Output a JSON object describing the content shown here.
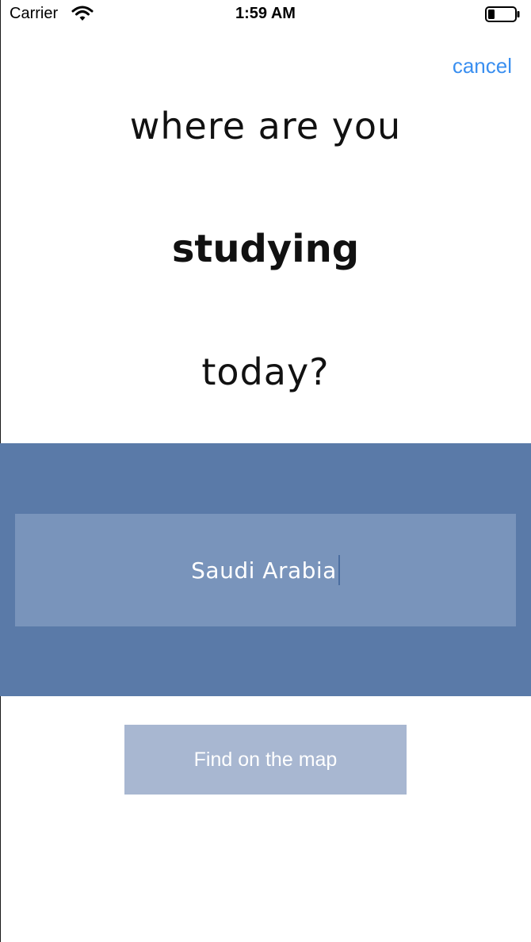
{
  "status_bar": {
    "carrier": "Carrier",
    "time": "1:59 AM",
    "wifi_icon": "wifi-icon",
    "battery_icon": "battery-icon"
  },
  "header": {
    "cancel_label": "cancel"
  },
  "question": {
    "line1": "where are you",
    "line2": "studying",
    "line3": "today?"
  },
  "location_input": {
    "value": "Saudi Arabia"
  },
  "find_button": {
    "label": "Find on the map"
  },
  "colors": {
    "accent": "#3a8ff0",
    "band": "#5a7aa8",
    "input_bg": "#7994bb",
    "button_bg": "#a8b7d1"
  }
}
